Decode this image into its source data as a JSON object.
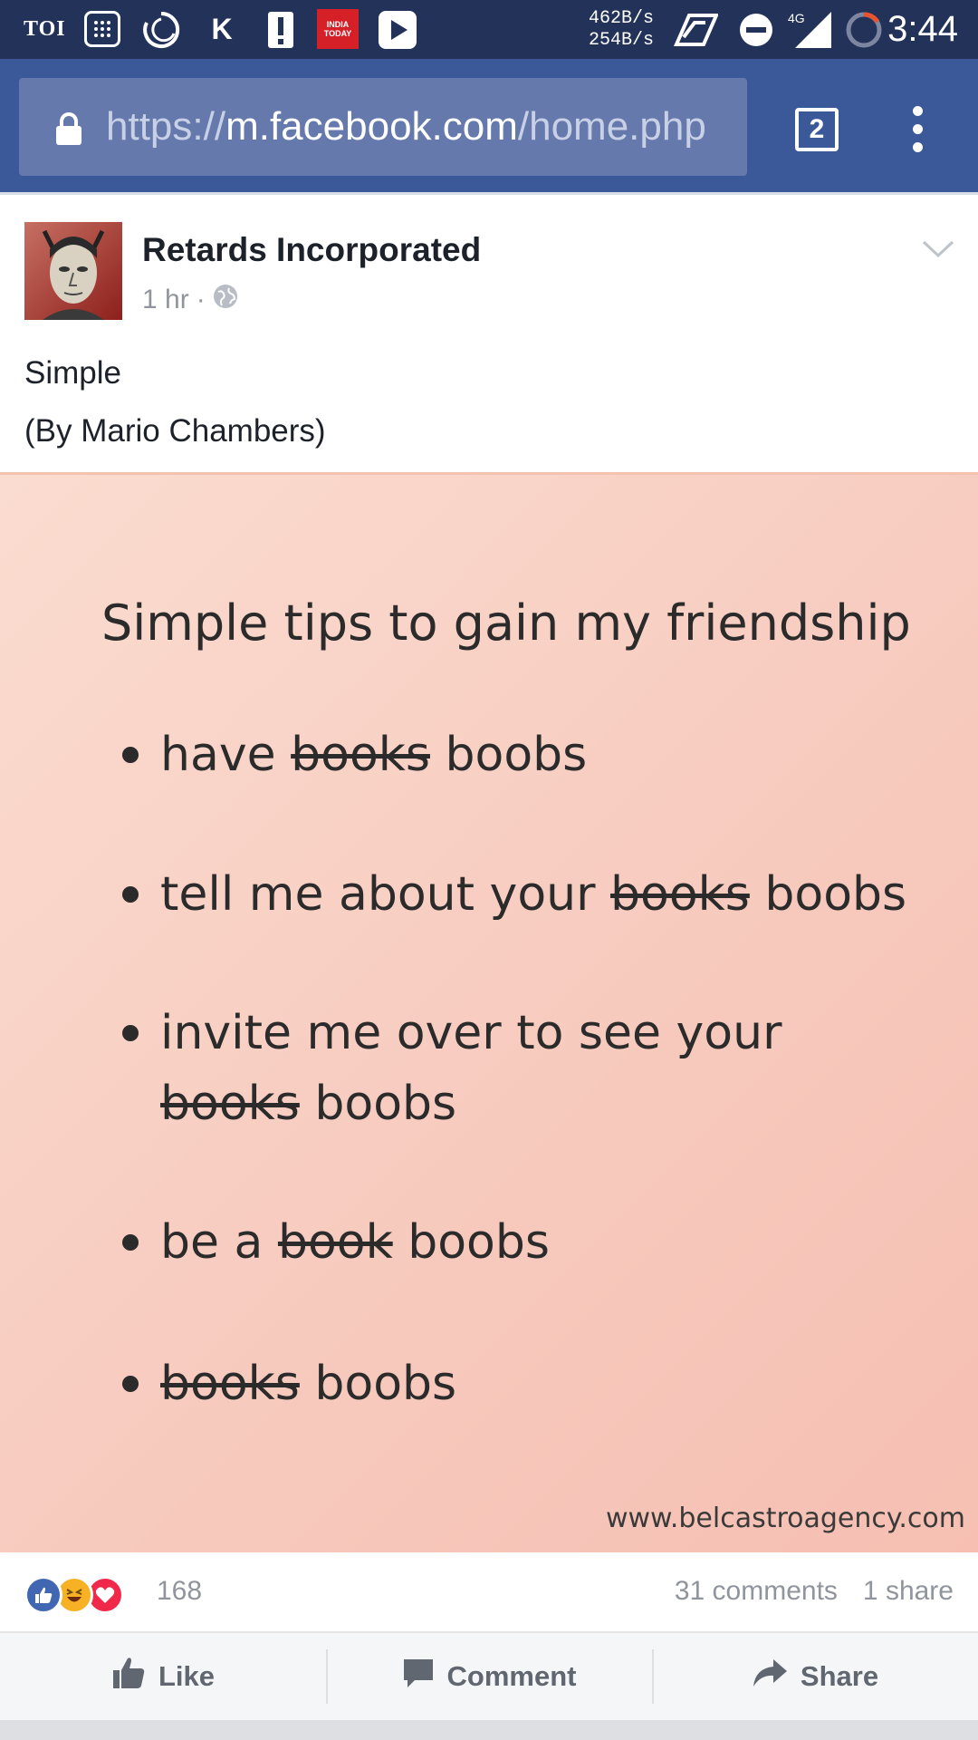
{
  "status_bar": {
    "carrier_label": "TOI",
    "india_today_label": "INDIA TODAY",
    "speed_up": "462B/s",
    "speed_down": "254B/s",
    "network_label": "4G",
    "time": "3:44"
  },
  "browser": {
    "url_scheme": "https://",
    "url_host": "m.facebook.com",
    "url_path": "/home.php",
    "tab_count": "2"
  },
  "post": {
    "page_name": "Retards Incorporated",
    "time_ago": "1 hr",
    "meta_separator": "·",
    "text_line1": "Simple",
    "text_line2": "(By Mario Chambers)"
  },
  "image": {
    "title": "Simple tips to gain my friendship",
    "tips": [
      {
        "pre": "have ",
        "struck": "books",
        "post": " boobs"
      },
      {
        "pre": "tell me about your ",
        "struck": "books",
        "post": " boobs"
      },
      {
        "pre": "invite me over to see your",
        "struck": "books",
        "post": " boobs"
      },
      {
        "pre": "be a ",
        "struck": "book",
        "post": " boobs"
      },
      {
        "pre": "",
        "struck": "books",
        "post": " boobs"
      }
    ],
    "watermark": "www.belcastroagency.com"
  },
  "reactions": {
    "count": "168",
    "comments": "31 comments",
    "shares": "1 share",
    "colors": {
      "like": "#4267b2",
      "haha": "#f7b125",
      "love": "#f0284a"
    }
  },
  "actions": {
    "like": "Like",
    "comment": "Comment",
    "share": "Share"
  }
}
